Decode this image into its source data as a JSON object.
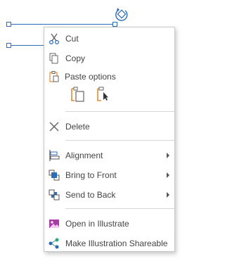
{
  "menu": {
    "items": [
      {
        "label": "Cut",
        "icon": "scissors-icon"
      },
      {
        "label": "Copy",
        "icon": "copy-icon"
      },
      {
        "label": "Paste options",
        "icon": "clipboard-icon"
      },
      {
        "label": "Delete",
        "icon": "delete-x-icon"
      },
      {
        "label": "Alignment",
        "icon": "alignment-icon",
        "submenu": true
      },
      {
        "label": "Bring to Front",
        "icon": "bring-to-front-icon",
        "submenu": true
      },
      {
        "label": "Send to Back",
        "icon": "send-to-back-icon",
        "submenu": true
      },
      {
        "label": "Open in Illustrate",
        "icon": "illustrate-image-icon"
      },
      {
        "label": "Make Illustration Shareable",
        "icon": "share-icon"
      }
    ],
    "paste_options": [
      {
        "name": "paste-keep-formatting",
        "icon": "paste-keep-source-icon"
      },
      {
        "name": "paste-picture",
        "icon": "paste-with-cursor-icon"
      }
    ]
  },
  "colors": {
    "accent_blue": "#2b6cb8",
    "icon_orange": "#e08a2e",
    "icon_purple": "#a93aa6",
    "text": "#444444",
    "separator": "#d8d8d8"
  }
}
